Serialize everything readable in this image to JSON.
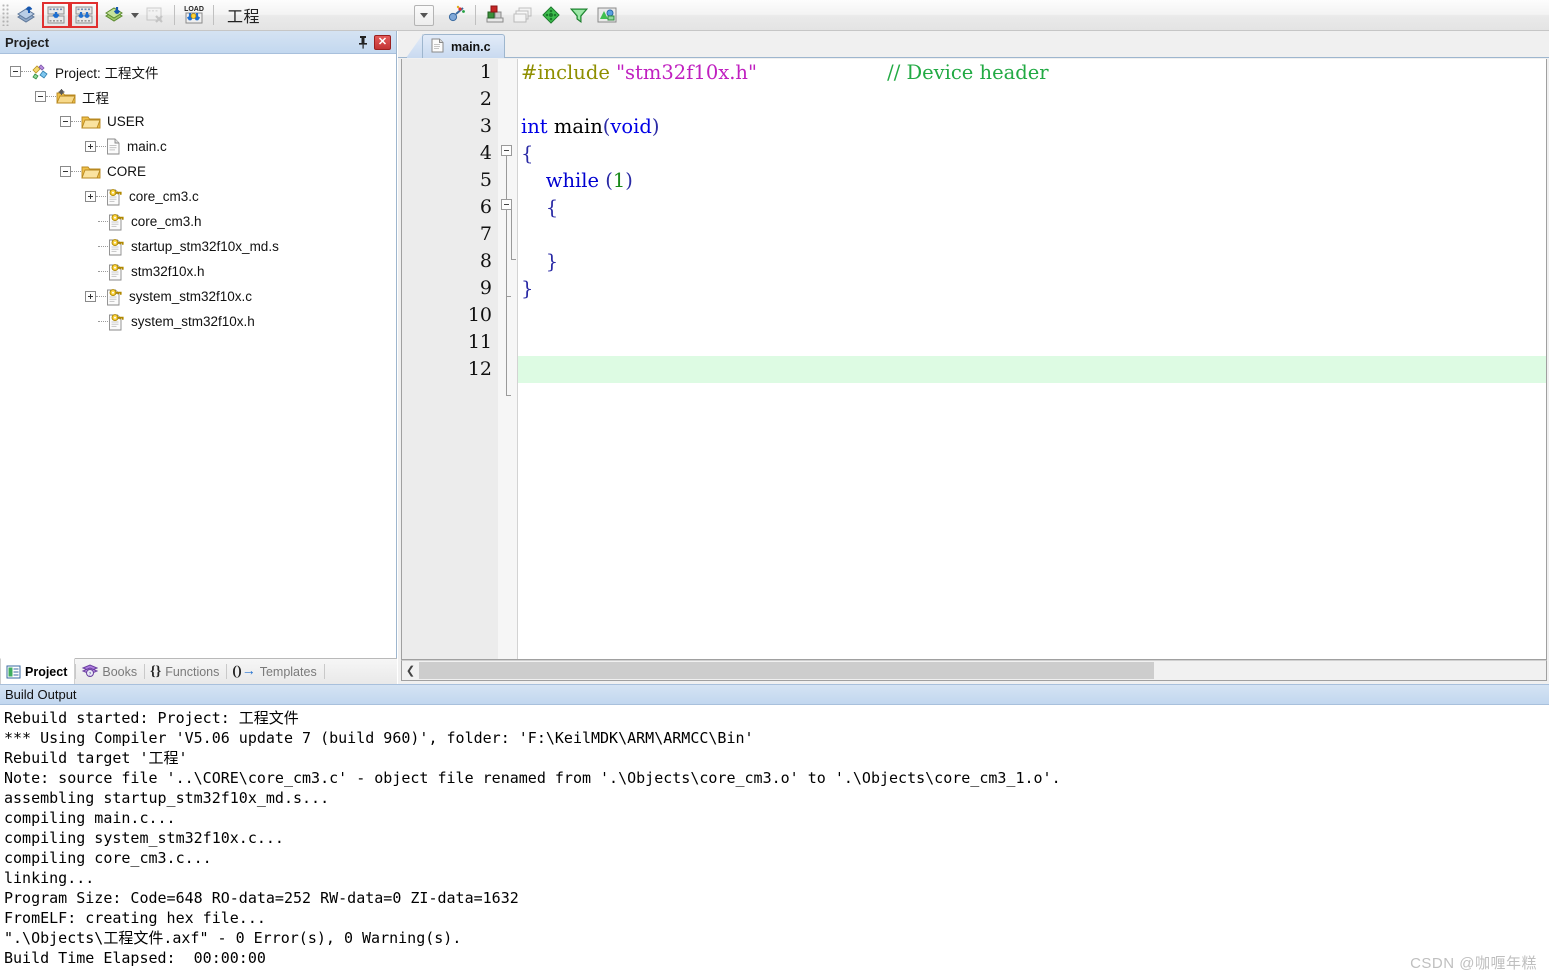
{
  "toolbar": {
    "buttons": [
      {
        "name": "translate-icon",
        "label": "Translate"
      },
      {
        "name": "build-icon",
        "label": "Build"
      },
      {
        "name": "rebuild-icon",
        "label": "Rebuild"
      },
      {
        "name": "batch-build-icon",
        "label": "Batch Build"
      },
      {
        "name": "stop-build-icon",
        "label": "Stop Build"
      },
      {
        "name": "download-icon",
        "label": "Download"
      },
      {
        "name": "target-options-icon",
        "label": "Options for Target"
      },
      {
        "name": "manage-components-icon",
        "label": "Manage Project Items"
      },
      {
        "name": "manage-layers-icon",
        "label": "Manage Multi-Project Workspace"
      },
      {
        "name": "pack-installer-icon",
        "label": "Pack Installer"
      },
      {
        "name": "run-configuration-icon",
        "label": "Configure Run"
      },
      {
        "name": "env-icon",
        "label": "Manage Run-Time Environment"
      }
    ],
    "target_select_value": "工程",
    "dropdown_caret": "▾"
  },
  "project_panel": {
    "title": "Project",
    "pin_tooltip": "Auto Hide",
    "close_label": "✕",
    "tree": [
      {
        "depth": 0,
        "label": "Project: 工程文件",
        "icon": "project-icon",
        "expander": "minus"
      },
      {
        "depth": 1,
        "label": "工程",
        "icon": "target-icon",
        "expander": "minus"
      },
      {
        "depth": 2,
        "label": "USER",
        "icon": "folder-icon",
        "expander": "minus"
      },
      {
        "depth": 3,
        "label": "main.c",
        "icon": "c-file-icon",
        "expander": "plus"
      },
      {
        "depth": 2,
        "label": "CORE",
        "icon": "folder-icon",
        "expander": "minus"
      },
      {
        "depth": 3,
        "label": "core_cm3.c",
        "icon": "key-file-icon",
        "expander": "plus"
      },
      {
        "depth": 3,
        "label": "core_cm3.h",
        "icon": "key-file-icon",
        "expander": "none"
      },
      {
        "depth": 3,
        "label": "startup_stm32f10x_md.s",
        "icon": "key-file-icon",
        "expander": "none"
      },
      {
        "depth": 3,
        "label": "stm32f10x.h",
        "icon": "key-file-icon",
        "expander": "none"
      },
      {
        "depth": 3,
        "label": "system_stm32f10x.c",
        "icon": "key-file-icon",
        "expander": "plus"
      },
      {
        "depth": 3,
        "label": "system_stm32f10x.h",
        "icon": "key-file-icon",
        "expander": "none"
      }
    ],
    "tabs": [
      {
        "label": "Project",
        "icon": "project-tab-icon",
        "active": true
      },
      {
        "label": "Books",
        "icon": "books-tab-icon",
        "active": false
      },
      {
        "label": "Functions",
        "icon": "functions-tab-icon",
        "active": false
      },
      {
        "label": "Templates",
        "icon": "templates-tab-icon",
        "active": false
      }
    ]
  },
  "editor": {
    "tab_label": "main.c",
    "tab_icon": "c-file-icon",
    "current_line": 12,
    "line_numbers": [
      "1",
      "2",
      "3",
      "4",
      "5",
      "6",
      "7",
      "8",
      "9",
      "10",
      "11",
      "12"
    ],
    "lines": [
      {
        "n": 1,
        "text": "#include \"stm32f10x.h\"                      // Device header"
      },
      {
        "n": 2,
        "text": ""
      },
      {
        "n": 3,
        "text": "int main(void)"
      },
      {
        "n": 4,
        "text": "{"
      },
      {
        "n": 5,
        "text": "    while (1)"
      },
      {
        "n": 6,
        "text": "    {"
      },
      {
        "n": 7,
        "text": ""
      },
      {
        "n": 8,
        "text": "    }"
      },
      {
        "n": 9,
        "text": "}"
      },
      {
        "n": 10,
        "text": ""
      },
      {
        "n": 11,
        "text": ""
      },
      {
        "n": 12,
        "text": ""
      }
    ],
    "tokens": {
      "include_directive": "#include",
      "include_string": "\"stm32f10x.h\"",
      "comment": "// Device header",
      "type_int": "int",
      "fn_main": "main",
      "paren_open": "(",
      "kw_void": "void",
      "paren_close": ")",
      "brace_open": "{",
      "brace_close": "}",
      "kw_while": "while",
      "while_arg": "(1)"
    },
    "scrollbar": {
      "left_arrow": "❮",
      "right_arrow": "❯"
    }
  },
  "build_output": {
    "title": "Build Output",
    "lines": [
      "Rebuild started: Project: 工程文件",
      "*** Using Compiler 'V5.06 update 7 (build 960)', folder: 'F:\\KeilMDK\\ARM\\ARMCC\\Bin'",
      "Rebuild target '工程'",
      "Note: source file '..\\CORE\\core_cm3.c' - object file renamed from '.\\Objects\\core_cm3.o' to '.\\Objects\\core_cm3_1.o'.",
      "assembling startup_stm32f10x_md.s...",
      "compiling main.c...",
      "compiling system_stm32f10x.c...",
      "compiling core_cm3.c...",
      "linking...",
      "Program Size: Code=648 RO-data=252 RW-data=0 ZI-data=1632",
      "FromELF: creating hex file...",
      "\".\\Objects\\工程文件.axf\" - 0 Error(s), 0 Warning(s).",
      "Build Time Elapsed:  00:00:00"
    ]
  },
  "watermark": "CSDN @咖喱年糕",
  "colors": {
    "panel_header": "#c9dcf0",
    "accent_border": "#9eb6ce",
    "current_line": "#ddfbe3",
    "close_red": "#c33434",
    "highlight_box_red": "#e03030",
    "comment_green": "#22aa44",
    "string_magenta": "#c020c0",
    "keyword_blue": "#0000e6",
    "preproc_olive": "#8f8f00"
  }
}
